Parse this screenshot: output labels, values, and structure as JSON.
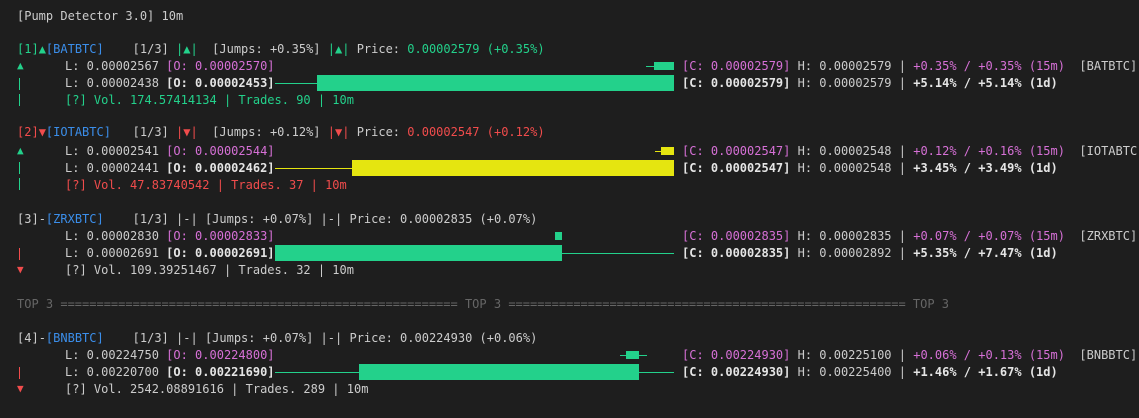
{
  "header": "[Pump Detector 3.0] 10m",
  "colors": {
    "green": "#23d18b",
    "red": "#f14c4c",
    "yellow": "#e5e510",
    "blue": "#3b8eea",
    "magenta": "#d670d6"
  },
  "pairs": [
    {
      "index": "[1]",
      "dir": "▲",
      "symbol": "BATBTC",
      "frac": "[1/3]",
      "trend": "|▲|",
      "jumps": "[Jumps: +0.35%]",
      "trend2": "|▲|",
      "price_label": "Price: ",
      "price": "0.00002579",
      "change": "(+0.35%)",
      "low1": "L: 0.00002567",
      "open1": "[O: 0.00002570]",
      "close1": "[C: 0.00002579]",
      "high1": "H: 0.00002579",
      "pct1": "+0.35% / +0.35% (15m)",
      "tag": "[BATBTC]",
      "low2": "L: 0.00002438",
      "open2": "[O: 0.00002453]",
      "close2": "[C: 0.00002579]",
      "high2": "H: 0.00002579",
      "pct2": "+5.14% / +5.14% (1d)",
      "vol": "[?] Vol. 174.57414134 | Trades. 90 | 10m"
    },
    {
      "index": "[2]",
      "dir": "▼",
      "symbol": "IOTABTC",
      "frac": "[1/3]",
      "trend": "|▼|",
      "jumps": "[Jumps: +0.12%]",
      "trend2": "|▼|",
      "price_label": "Price: ",
      "price": "0.00002547",
      "change": "(+0.12%)",
      "low1": "L: 0.00002541",
      "open1": "[O: 0.00002544]",
      "close1": "[C: 0.00002547]",
      "high1": "H: 0.00002548",
      "pct1": "+0.12% / +0.16% (15m)",
      "tag": "[IOTABTC]",
      "low2": "L: 0.00002441",
      "open2": "[O: 0.00002462]",
      "close2": "[C: 0.00002547]",
      "high2": "H: 0.00002548",
      "pct2": "+3.45% / +3.49% (1d)",
      "vol": "[?] Vol. 47.83740542 | Trades. 37 | 10m"
    },
    {
      "index": "[3]",
      "dir": "-",
      "symbol": "ZRXBTC",
      "frac": "[1/3]",
      "trend": "|-|",
      "jumps": "[Jumps: +0.07%]",
      "trend2": "|-|",
      "price_label": "Price: ",
      "price": "0.00002835",
      "change": "(+0.07%)",
      "low1": "L: 0.00002830",
      "open1": "[O: 0.00002833]",
      "close1": "[C: 0.00002835]",
      "high1": "H: 0.00002835",
      "pct1": "+0.07% / +0.07% (15m)",
      "tag": "[ZRXBTC]",
      "low2": "L: 0.00002691",
      "open2": "[O: 0.00002691]",
      "close2": "[C: 0.00002835]",
      "high2": "H: 0.00002892",
      "pct2": "+5.35% / +7.47% (1d)",
      "vol": "[?] Vol. 109.39251467 | Trades. 32 | 10m"
    },
    {
      "index": "[4]",
      "dir": "-",
      "symbol": "BNBBTC",
      "frac": "[1/3]",
      "trend": "|-|",
      "jumps": "[Jumps: +0.07%]",
      "trend2": "|-|",
      "price_label": "Price: ",
      "price": "0.00224930",
      "change": "(+0.06%)",
      "low1": "L: 0.00224750",
      "open1": "[O: 0.00224800]",
      "close1": "[C: 0.00224930]",
      "high1": "H: 0.00225100",
      "pct1": "+0.06% / +0.13% (15m)",
      "tag": "[BNBBTC]",
      "low2": "L: 0.00220700",
      "open2": "[O: 0.00221690]",
      "close2": "[C: 0.00224930]",
      "high2": "H: 0.00225400",
      "pct2": "+1.46% / +1.67% (1d)",
      "vol": "[?] Vol. 2542.08891616 | Trades. 289 | 10m"
    }
  ],
  "separator": {
    "label": "TOP 3",
    "rule_left": "=======================================================",
    "rule_right": "======================================================="
  },
  "separator_label2": "TOP 3",
  "separator_label3": "TOP 3"
}
